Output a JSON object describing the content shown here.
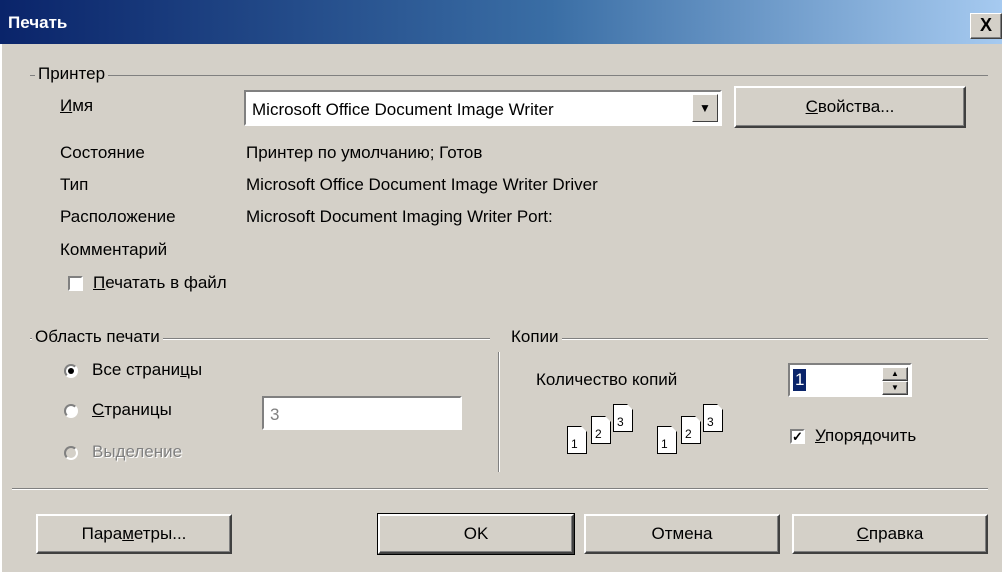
{
  "window": {
    "title": "Печать",
    "close_glyph": "X"
  },
  "printer": {
    "group_label": "Принтер",
    "name_label_u": "И",
    "name_label_rest": "мя",
    "name_value": "Microsoft Office Document Image Writer",
    "properties_u": "С",
    "properties_rest": "войства...",
    "status_label": "Состояние",
    "status_value": "Принтер по умолчанию; Готов",
    "type_label": "Тип",
    "type_value": "Microsoft Office Document Image Writer Driver",
    "location_label": "Расположение",
    "location_value": "Microsoft Document Imaging Writer Port:",
    "comment_label": "Комментарий",
    "print_to_file_u": "П",
    "print_to_file_rest": "ечатать в файл",
    "print_to_file_checked": false
  },
  "range": {
    "group_label": "Область печати",
    "all_pages": "Все страни",
    "all_pages_u": "ц",
    "all_pages_end": "ы",
    "pages_u": "С",
    "pages_rest": "траницы",
    "pages_value": "3",
    "selection": "Выделение",
    "selected": "all"
  },
  "copies": {
    "group_label": "Копии",
    "count_label": "Количество копий",
    "count_value": "1",
    "collate_u": "У",
    "collate_rest": "порядочить",
    "collate_checked": true,
    "page_numbers": [
      "1",
      "2",
      "3"
    ]
  },
  "buttons": {
    "params_pre": "Пара",
    "params_u": "м",
    "params_post": "етры...",
    "ok": "OK",
    "cancel": "Отмена",
    "help_u": "С",
    "help_rest": "правка"
  }
}
